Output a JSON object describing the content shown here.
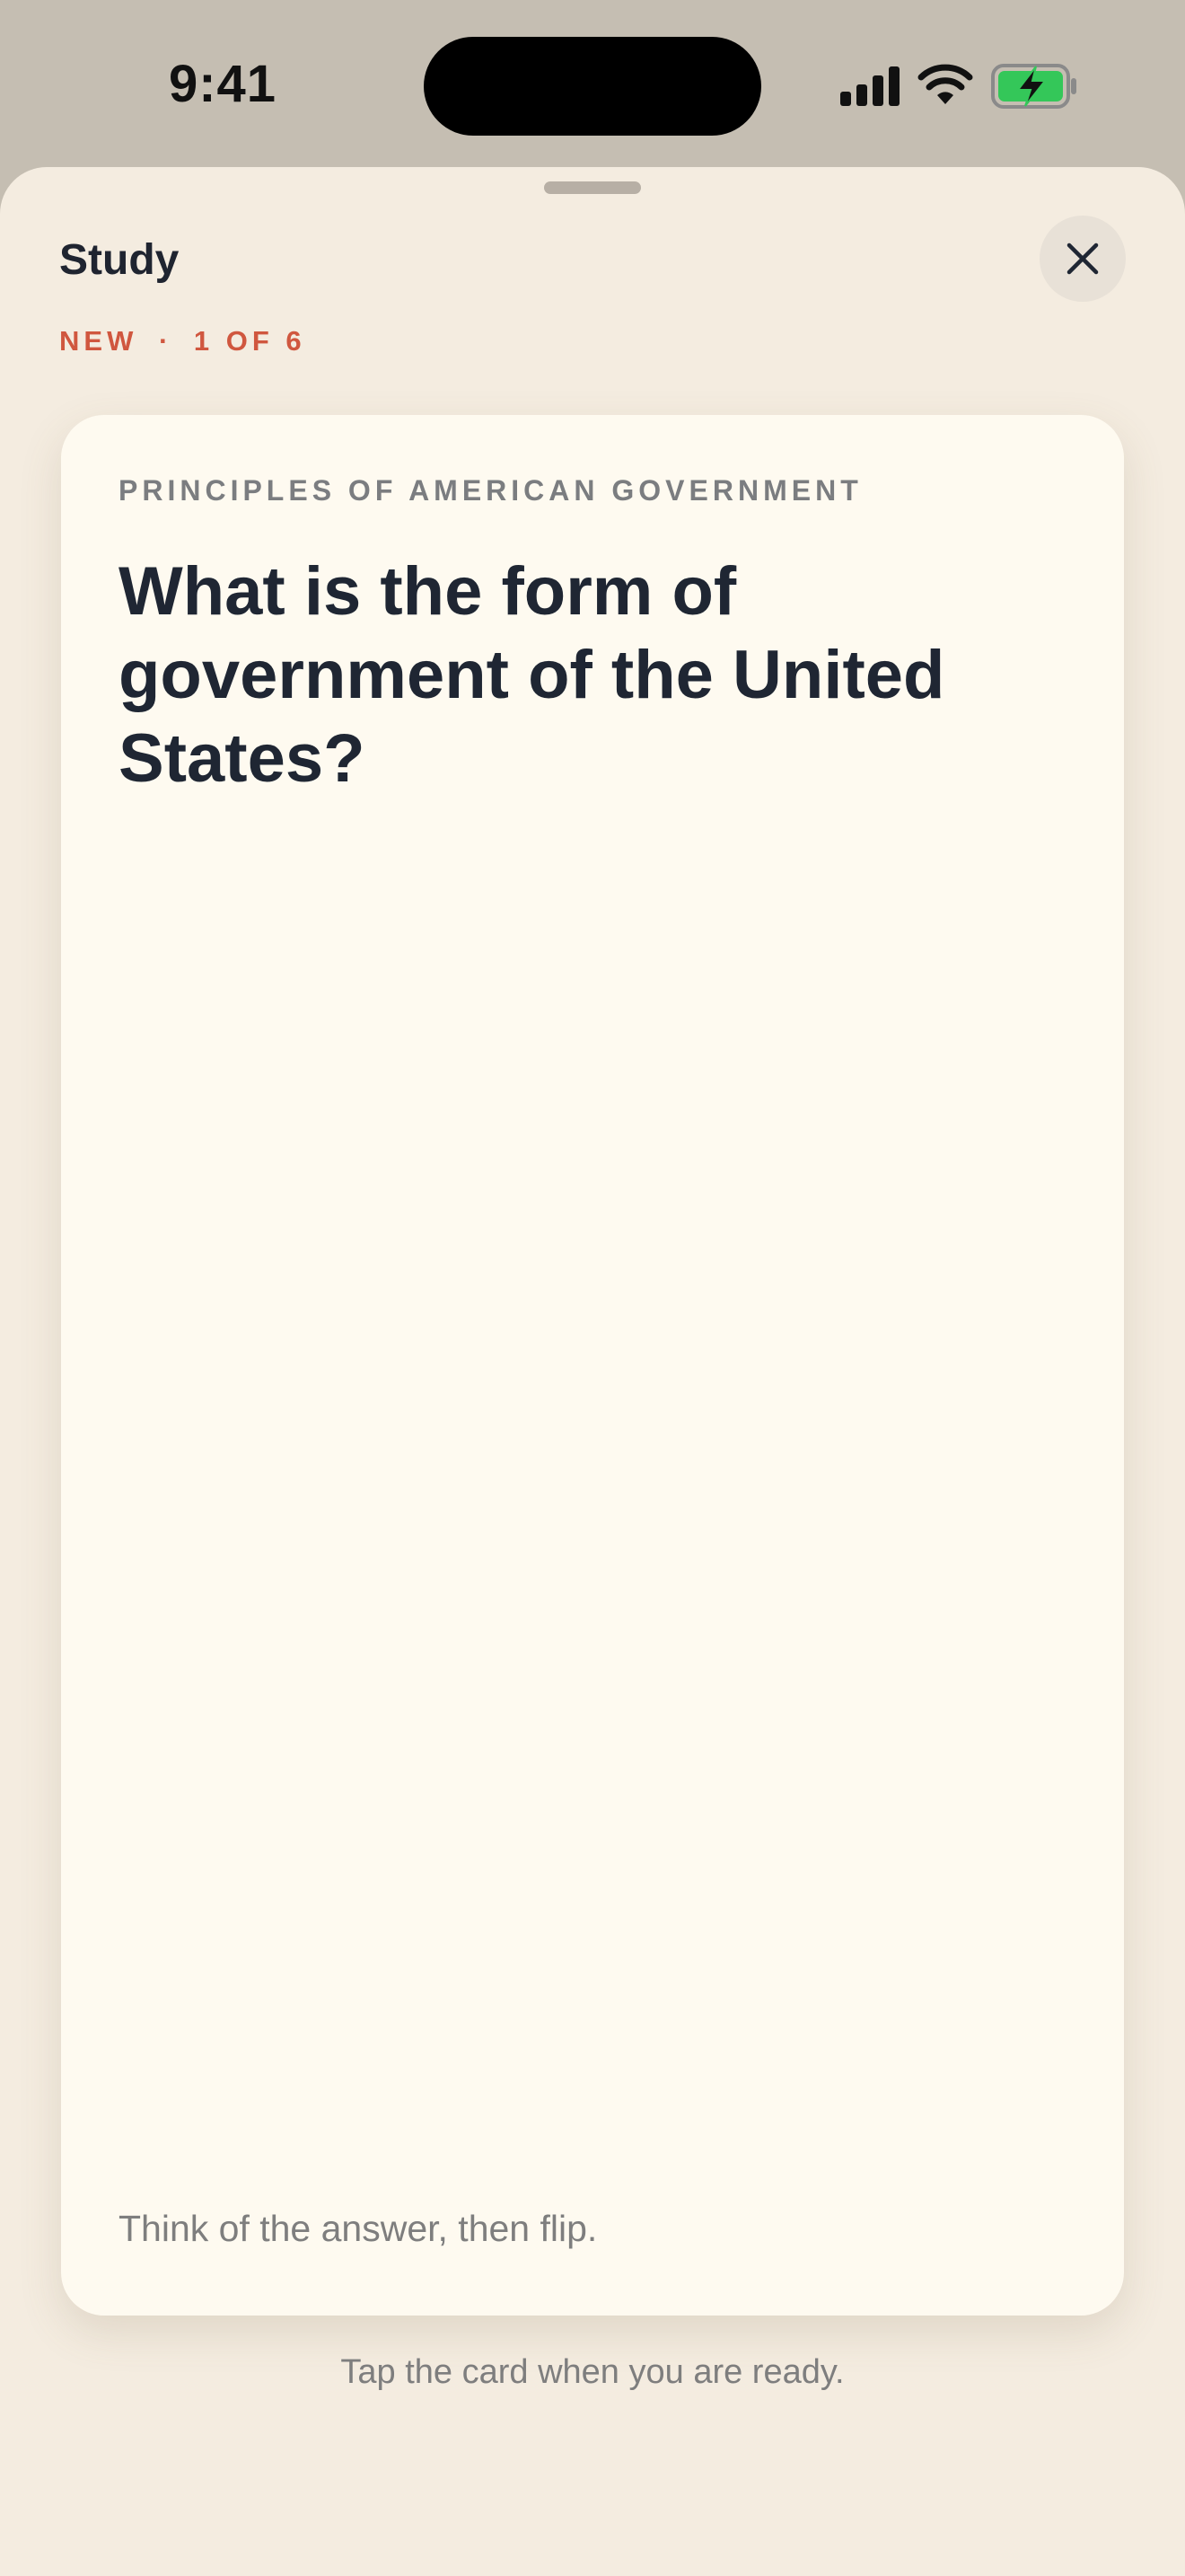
{
  "status_bar": {
    "time": "9:41",
    "signal_icon": "cellular-signal-icon",
    "wifi_icon": "wifi-icon",
    "battery_icon": "battery-charging-icon",
    "battery_color": "#34c759"
  },
  "sheet": {
    "title": "Study",
    "status": {
      "label": "NEW",
      "separator": "·",
      "progress": "1 OF 6"
    },
    "close_icon": "close-icon"
  },
  "card": {
    "category": "PRINCIPLES OF AMERICAN GOVERNMENT",
    "question": "What is the form of government of the United States?",
    "hint": "Think of the answer, then flip."
  },
  "footer": {
    "hint": "Tap the card when you are ready."
  },
  "colors": {
    "accent": "#d0573f",
    "sheet_background": "#f4ece0",
    "card_background": "#fefaf0",
    "text_primary": "#1f2633",
    "text_secondary": "#7e7e7e"
  }
}
